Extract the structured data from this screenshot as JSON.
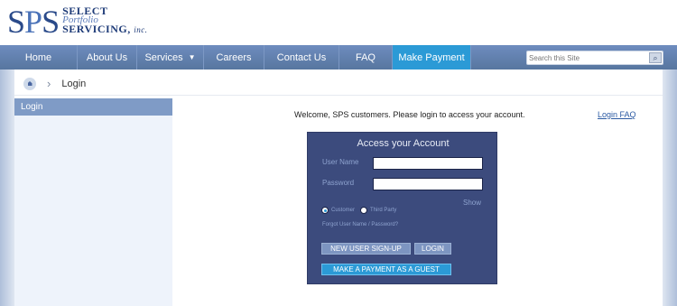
{
  "logo": {
    "mark_s1": "S",
    "mark_p": "P",
    "mark_s2": "S",
    "line1": "SELECT",
    "line2": "Portfolio",
    "line3": "SERVICING,",
    "inc": "inc."
  },
  "nav": {
    "items": [
      {
        "label": "Home"
      },
      {
        "label": "About Us"
      },
      {
        "label": "Services"
      },
      {
        "label": "Careers"
      },
      {
        "label": "Contact Us"
      },
      {
        "label": "FAQ"
      },
      {
        "label": "Make Payment"
      }
    ],
    "services_chevron": "chevron-down-icon",
    "search": {
      "placeholder": "Search this Site",
      "icon": "search-icon"
    }
  },
  "breadcrumb": {
    "home_icon": "home-icon",
    "separator": "›",
    "current": "Login"
  },
  "sidebar": {
    "heading": "Login"
  },
  "main": {
    "welcome": "Welcome, SPS customers. Please login to access your account.",
    "faq_link": "Login FAQ"
  },
  "login": {
    "title": "Access your Account",
    "username_label": "User Name",
    "username_value": "",
    "password_label": "Password",
    "password_value": "",
    "show_label": "Show",
    "radio_customer": "Customer",
    "radio_third_party": "Third Party",
    "selected_radio": "Customer",
    "forgot": "Forgot User Name / Password?",
    "signup_button": "NEW USER SIGN-UP",
    "login_button": "LOGIN",
    "guest_button": "MAKE A PAYMENT AS A GUEST"
  },
  "colors": {
    "nav_bar": "#6e8cbf",
    "make_payment": "#2b9ad6",
    "login_box": "#3c4b7d",
    "sidebar_head": "#7f9bc6",
    "link": "#2b5aa3"
  }
}
